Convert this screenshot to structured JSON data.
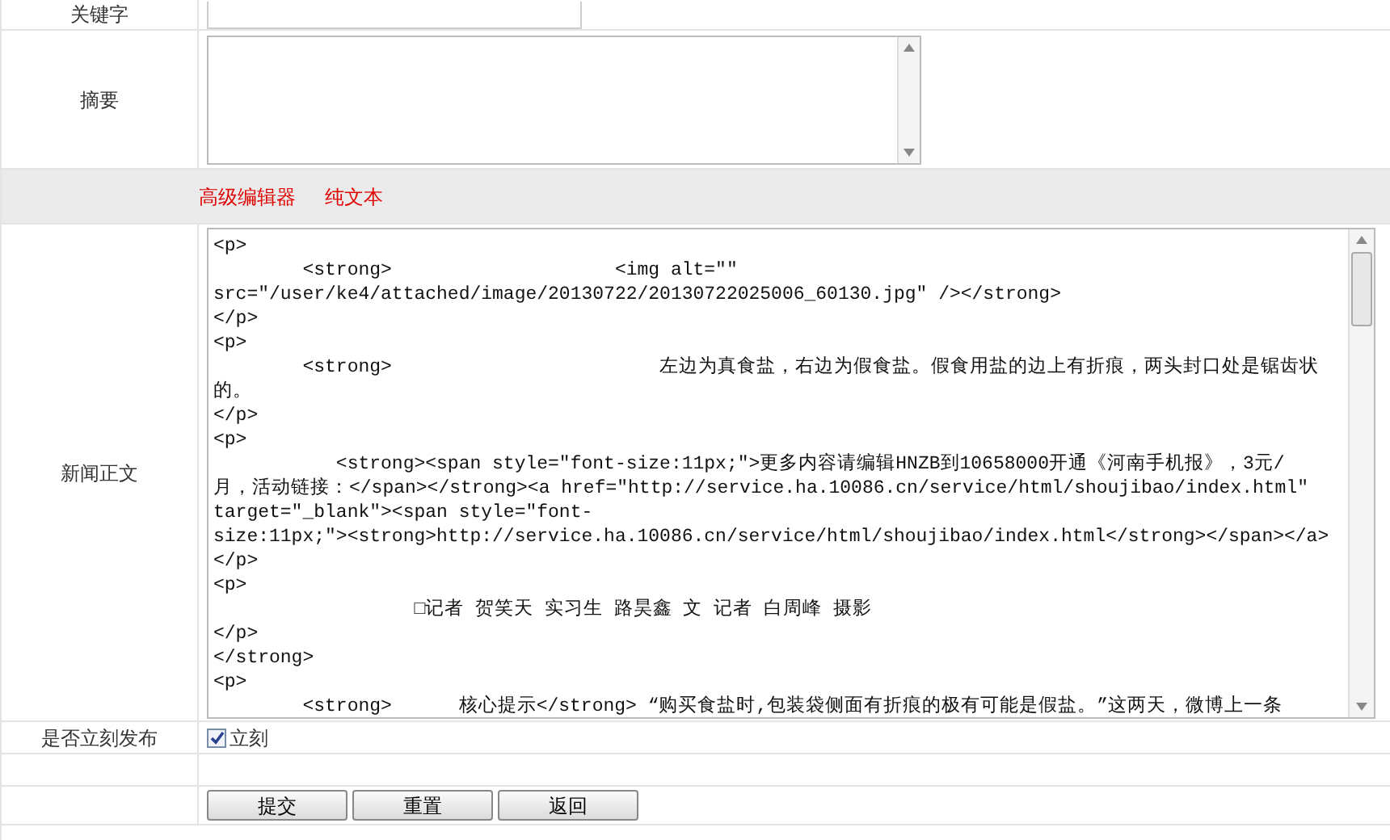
{
  "keyword": {
    "label": "关键字"
  },
  "summary": {
    "label": "摘要"
  },
  "editor_tabs": [
    "高级编辑器",
    "纯文本"
  ],
  "body": {
    "label": "新闻正文",
    "lines": [
      "<p>",
      "        <strong>                    <img alt=\"\"",
      "src=\"/user/ke4/attached/image/20130722/20130722025006_60130.jpg\" /></strong>",
      "</p>",
      "<p>",
      "        <strong>                        左边为真食盐，右边为假食盐。假食用盐的边上有折痕，两头封口处是锯齿状",
      "的。",
      "</p>",
      "<p>",
      "           <strong><span style=\"font-size:11px;\">更多内容请编辑HNZB到10658000开通《河南手机报》，3元/",
      "月，活动链接：</span></strong><a href=\"http://service.ha.10086.cn/service/html/shoujibao/index.html\"",
      "target=\"_blank\"><span style=\"font-",
      "size:11px;\"><strong>http://service.ha.10086.cn/service/html/shoujibao/index.html</strong></span></a>",
      "</p>",
      "<p>",
      "                  □记者 贺笑天 实习生 路昊鑫 文 记者 白周峰 摄影",
      "</p>",
      "</strong>",
      "<p>",
      "        <strong>      核心提示</strong> “购买食盐时,包装袋侧面有折痕的极有可能是假盐。”这两天，微博上一条"
    ]
  },
  "publish": {
    "label": "是否立刻发布",
    "checkbox_label": "立刻",
    "checked": true
  },
  "buttons": [
    "提交",
    "重置",
    "返回"
  ]
}
